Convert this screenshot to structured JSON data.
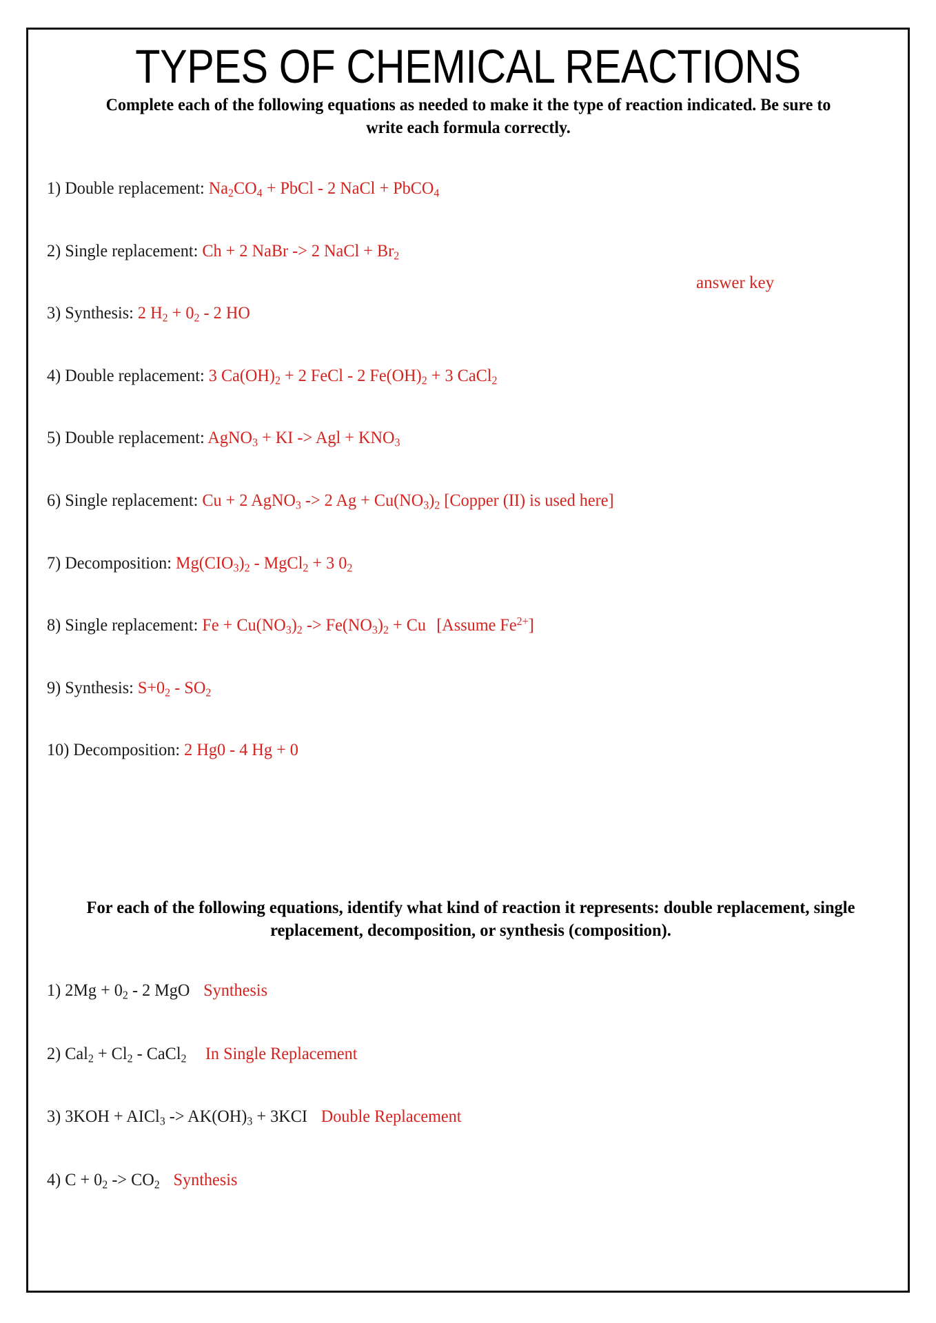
{
  "document": {
    "title": "TYPES OF CHEMICAL REACTIONS",
    "subtitle": "Complete each of the following equations as needed to make it the type of reaction indicated.  Be sure to write each formula correctly.",
    "annotation": "answer key",
    "answer_color": "#d5231f",
    "text_color": "#1a1a1a"
  },
  "section_one": {
    "items": [
      {
        "number": "1)",
        "prompt": "Double replacement:",
        "answer_plain": "Na2CO4 + PbCl - 2 NaCl + PbCO4"
      },
      {
        "number": "2)",
        "prompt": "Single replacement:",
        "answer_plain": "Ch + 2 NaBr -> 2 NaCl + Br2"
      },
      {
        "number": "3)",
        "prompt": "Synthesis:",
        "answer_plain": "2 H2 + 02 - 2 HO"
      },
      {
        "number": "4)",
        "prompt": "Double replacement:",
        "answer_plain": "3 Ca(OH)2 + 2 FeCl - 2 Fe(OH)2 + 3 CaCl2"
      },
      {
        "number": "5)",
        "prompt": "Double replacement:",
        "answer_plain": "AgNO3 + KI -> Agl + KNO3"
      },
      {
        "number": "6)",
        "prompt": "Single replacement:",
        "answer_plain": "Cu + 2 AgNO3 -> 2 Ag + Cu(NO3)2 [Copper (II) is used here]"
      },
      {
        "number": "7)",
        "prompt": "Decomposition:",
        "answer_plain": "Mg(CIO3)2 - MgCl2 + 3 02"
      },
      {
        "number": "8)",
        "prompt": "Single replacement:",
        "answer_plain": "Fe + Cu(NO3)2 -> Fe(NO3)2 + Cu   [Assume Fe2+]"
      },
      {
        "number": "9)",
        "prompt": "Synthesis:",
        "answer_plain": "S+02 - SO2"
      },
      {
        "number": "10)",
        "prompt": "Decomposition:",
        "answer_plain": "2 Hg0 - 4 Hg + 0"
      }
    ]
  },
  "mid_instruction": "For each of the following equations, identify what kind of reaction it represents: double replacement, single replacement, decomposition, or synthesis (composition).",
  "section_two": {
    "items": [
      {
        "number": "1)",
        "equation_plain": "2Mg + 02 - 2 MgO",
        "answer": "Synthesis"
      },
      {
        "number": "2)",
        "equation_plain": "Cal2 + Cl2 - CaCl2",
        "answer": "In Single Replacement"
      },
      {
        "number": "3)",
        "equation_plain": "3KOH + AICl3 -> AK(OH)3 + 3KCI",
        "answer": "Double Replacement"
      },
      {
        "number": "4)",
        "equation_plain": "C + 02 -> CO2",
        "answer": "Synthesis"
      }
    ]
  }
}
